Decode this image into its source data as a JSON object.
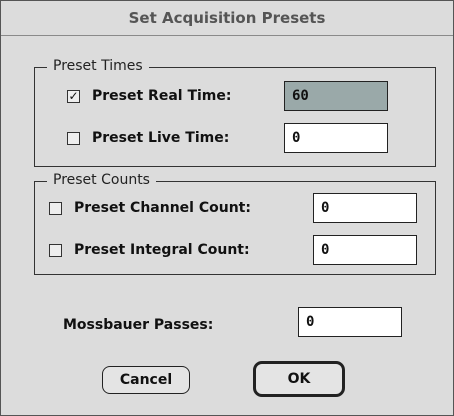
{
  "dialog": {
    "title": "Set Acquisition Presets"
  },
  "preset_times": {
    "legend": "Preset Times",
    "real_time": {
      "label": "Preset Real Time:",
      "checked": true,
      "value": "60"
    },
    "live_time": {
      "label": "Preset Live Time:",
      "checked": false,
      "value": "0"
    }
  },
  "preset_counts": {
    "legend": "Preset Counts",
    "channel_count": {
      "label": "Preset Channel Count:",
      "checked": false,
      "value": "0"
    },
    "integral_count": {
      "label": "Preset Integral Count:",
      "checked": false,
      "value": "0"
    }
  },
  "mossbauer": {
    "label": "Mossbauer Passes:",
    "value": "0"
  },
  "buttons": {
    "cancel": "Cancel",
    "ok": "OK"
  },
  "icons": {
    "checked": "checkmark-icon",
    "unchecked": "empty-checkbox"
  },
  "colors": {
    "background": "#dcdcdc",
    "active_field": "#9aa9a9"
  }
}
